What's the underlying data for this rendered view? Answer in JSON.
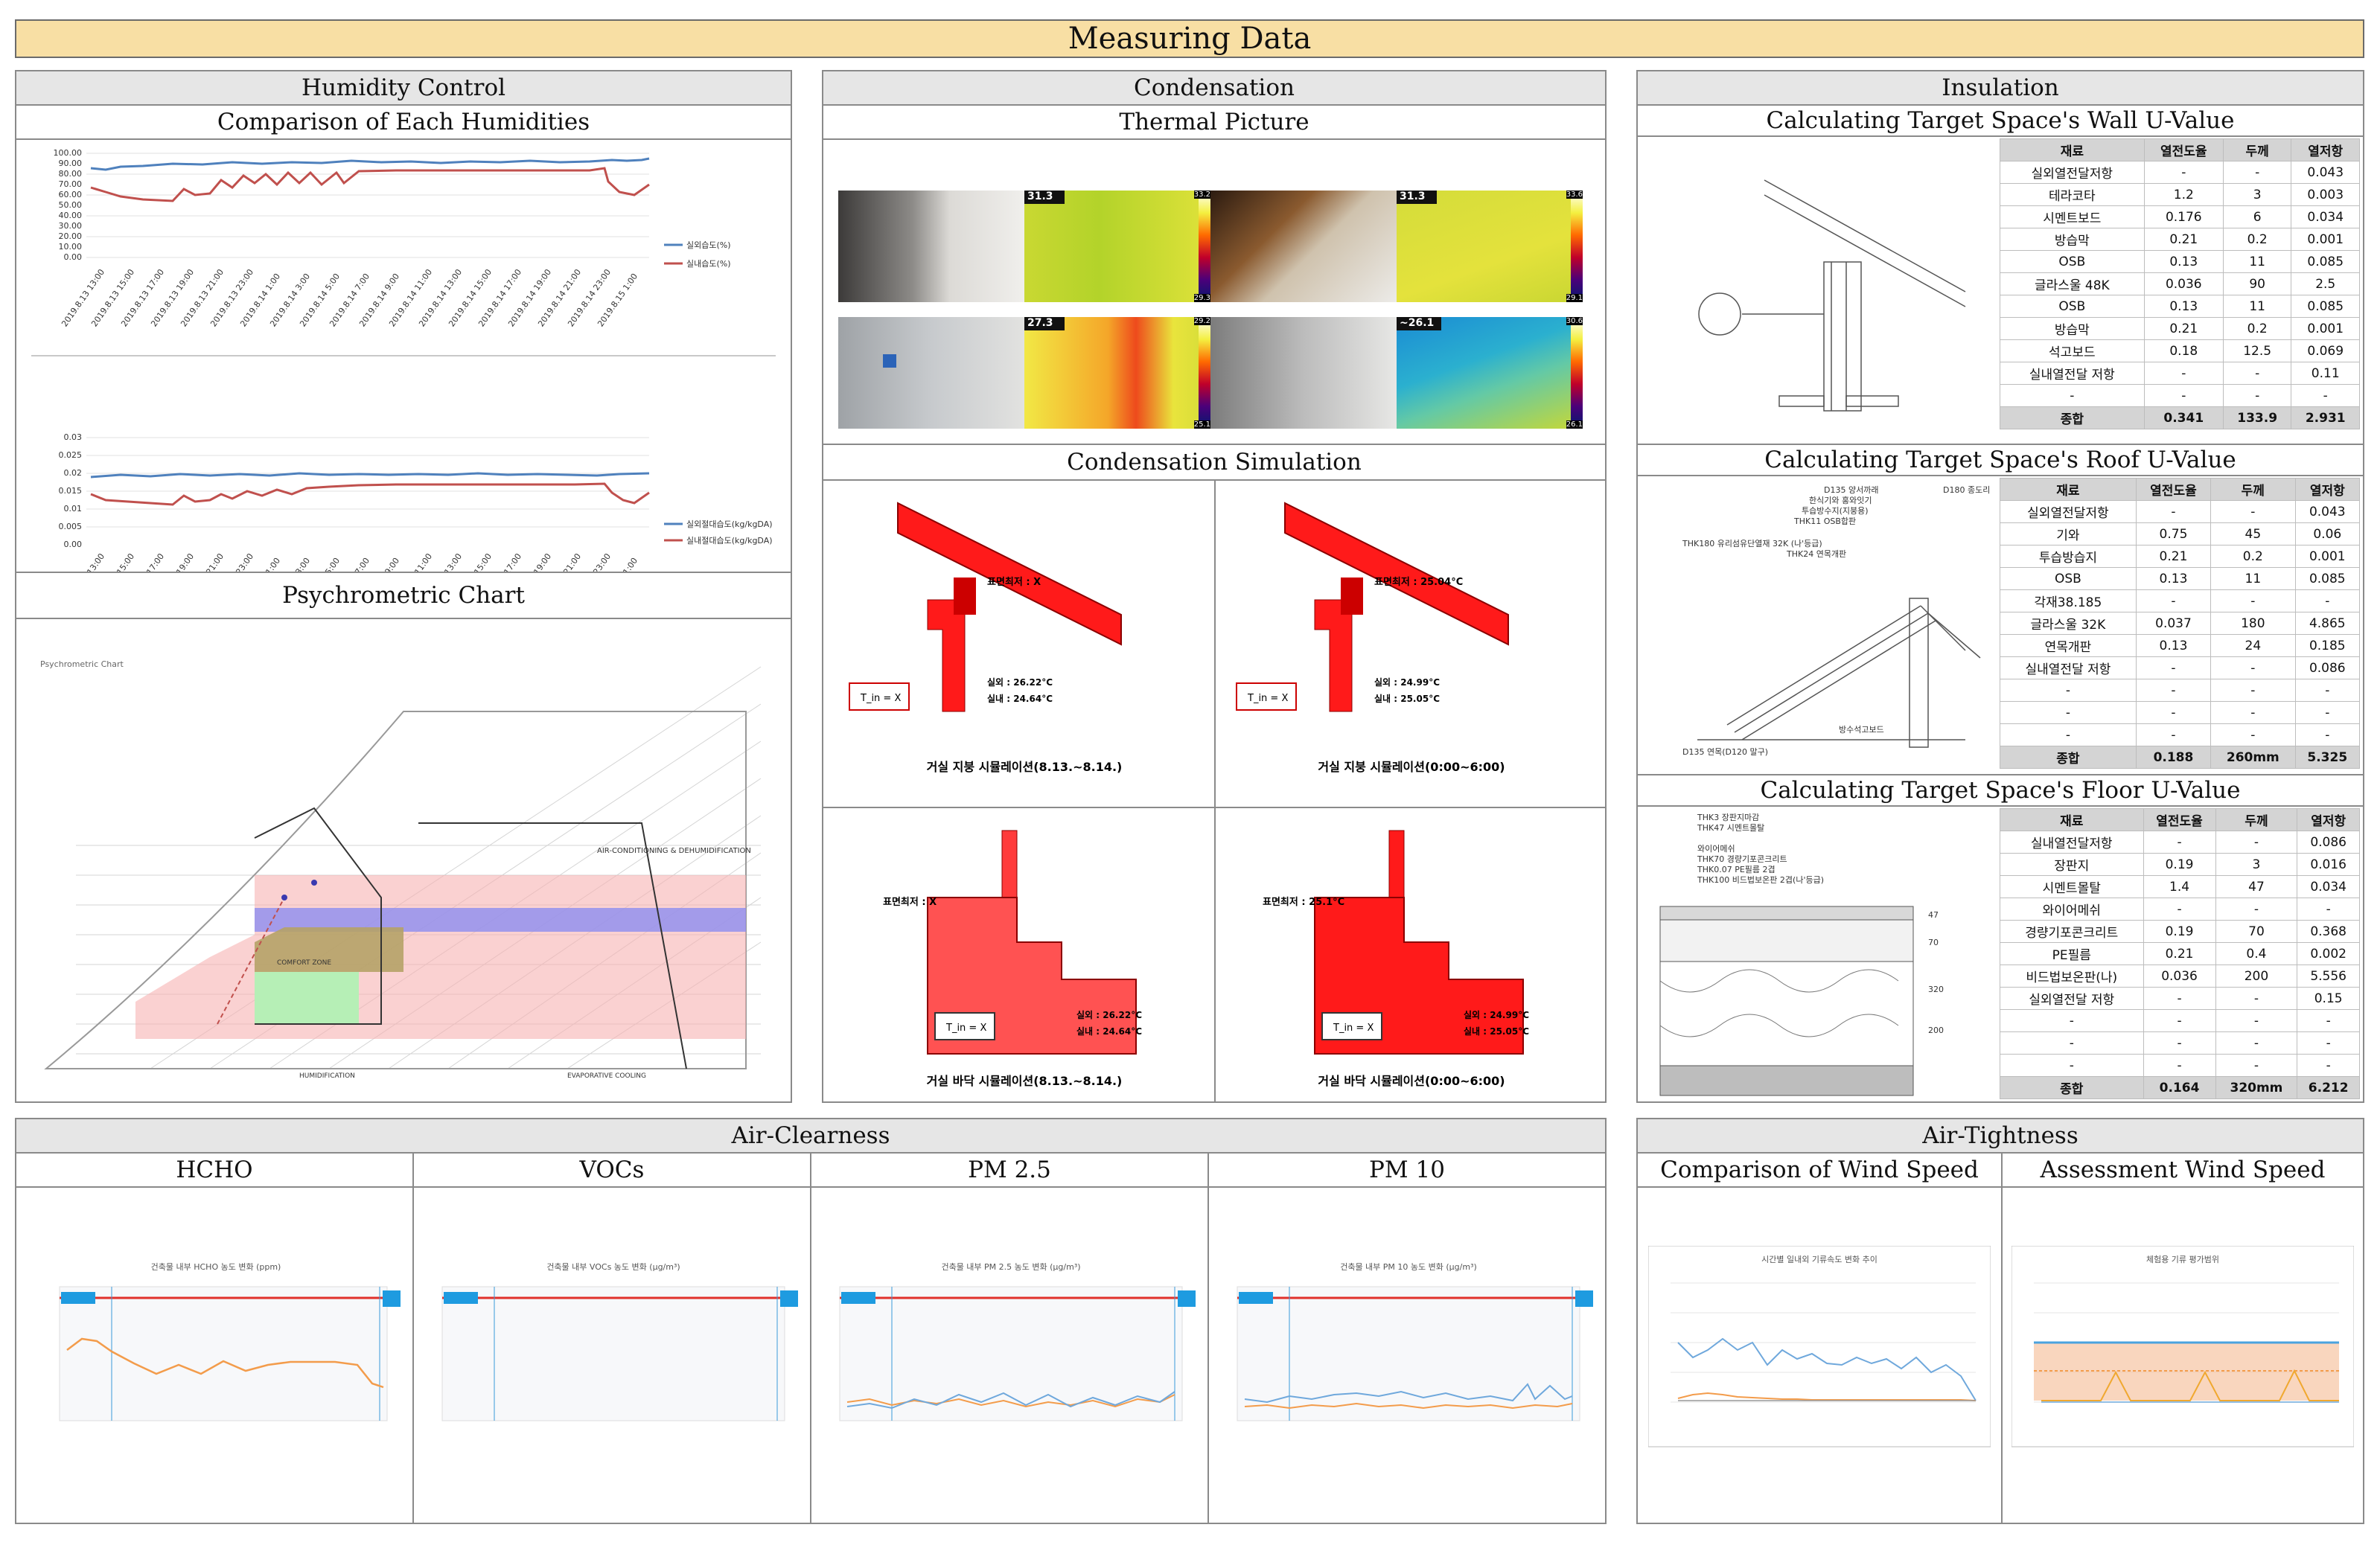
{
  "title": "Measuring Data",
  "humidity": {
    "header": "Humidity Control",
    "sub1": "Comparison of Each Humidities",
    "sub2": "Psychrometric Chart",
    "chart1": {
      "yticks": [
        "100.00",
        "90.00",
        "80.00",
        "70.00",
        "60.00",
        "50.00",
        "40.00",
        "30.00",
        "20.00",
        "10.00",
        "0.00"
      ],
      "legend": [
        "실외습도(%)",
        "실내습도(%)"
      ]
    },
    "chart2": {
      "yticks": [
        "0.03",
        "0.025",
        "0.02",
        "0.015",
        "0.01",
        "0.005",
        "0.00"
      ],
      "legend": [
        "실외절대습도(kg/kgDA)",
        "실내절대습도(kg/kgDA)"
      ]
    },
    "psychro": {
      "title": "Psychrometric Chart",
      "zones": [
        "AIR-CONDITIONING & DEHUMIDIFICATION",
        "COMFORT ZONE",
        "HUMIDIFICATION",
        "EVAPORATIVE COOLING"
      ]
    }
  },
  "condensation": {
    "header": "Condensation",
    "sub1": "Thermal Picture",
    "sub2": "Condensation Simulation",
    "thermal": [
      {
        "reading": "31.3",
        "max": "33.2",
        "min": "29.3"
      },
      {
        "reading": "31.3",
        "max": "33.6",
        "min": "29.1"
      },
      {
        "reading": "27.3",
        "max": "29.2",
        "min": "25.1"
      },
      {
        "reading": "~26.1",
        "max": "30.6",
        "min": "26.1"
      }
    ],
    "sims": [
      {
        "surface": "표면최저 : X",
        "out": "실외 : 26.22°C",
        "in": "실내 : 24.64°C",
        "box": "T_in = X",
        "caption": "거실 지붕 시뮬레이션(8.13.~8.14.)"
      },
      {
        "surface": "표면최저 : 25.04°C",
        "out": "실외 : 24.99°C",
        "in": "실내 : 25.05°C",
        "box": "T_in = X",
        "caption": "거실 지붕 시뮬레이션(0:00~6:00)"
      },
      {
        "surface": "표면최저 : X",
        "out": "실외 : 26.22°C",
        "in": "실내 : 24.64°C",
        "box": "T_in = X",
        "caption": "거실 바닥 시뮬레이션(8.13.~8.14.)"
      },
      {
        "surface": "표면최저 : 25.1°C",
        "out": "실외 : 24.99°C",
        "in": "실내 : 25.05°C",
        "box": "T_in = X",
        "caption": "거실 바닥 시뮬레이션(0:00~6:00)"
      }
    ]
  },
  "insulation": {
    "header": "Insulation",
    "wall": {
      "sub": "Calculating Target Space's Wall U-Value",
      "cols": [
        "재료",
        "열전도율",
        "두께",
        "열저항"
      ],
      "rows": [
        [
          "실외열전달저항",
          "-",
          "-",
          "0.043"
        ],
        [
          "테라코타",
          "1.2",
          "3",
          "0.003"
        ],
        [
          "시멘트보드",
          "0.176",
          "6",
          "0.034"
        ],
        [
          "방습막",
          "0.21",
          "0.2",
          "0.001"
        ],
        [
          "OSB",
          "0.13",
          "11",
          "0.085"
        ],
        [
          "글라스울 48K",
          "0.036",
          "90",
          "2.5"
        ],
        [
          "OSB",
          "0.13",
          "11",
          "0.085"
        ],
        [
          "방습막",
          "0.21",
          "0.2",
          "0.001"
        ],
        [
          "석고보드",
          "0.18",
          "12.5",
          "0.069"
        ],
        [
          "실내열전달 저항",
          "-",
          "-",
          "0.11"
        ],
        [
          "-",
          "-",
          "-",
          "-"
        ]
      ],
      "total": [
        "종합",
        "0.341",
        "133.9",
        "2.931"
      ]
    },
    "roof": {
      "sub": "Calculating Target Space's Roof U-Value",
      "cols": [
        "재료",
        "열전도율",
        "두께",
        "열저항"
      ],
      "rows": [
        [
          "실외열전달저항",
          "-",
          "-",
          "0.043"
        ],
        [
          "기와",
          "0.75",
          "45",
          "0.06"
        ],
        [
          "투습방습지",
          "0.21",
          "0.2",
          "0.001"
        ],
        [
          "OSB",
          "0.13",
          "11",
          "0.085"
        ],
        [
          "각재38.185",
          "-",
          "-",
          "-"
        ],
        [
          "글라스울 32K",
          "0.037",
          "180",
          "4.865"
        ],
        [
          "연목개판",
          "0.13",
          "24",
          "0.185"
        ],
        [
          "실내열전달 저항",
          "-",
          "-",
          "0.086"
        ],
        [
          "-",
          "-",
          "-",
          "-"
        ],
        [
          "-",
          "-",
          "-",
          "-"
        ],
        [
          "-",
          "-",
          "-",
          "-"
        ]
      ],
      "total": [
        "종합",
        "0.188",
        "260mm",
        "5.325"
      ],
      "labels": [
        "D135 양서까래",
        "한식기와 홍와잇기",
        "투습방수지(지붕용)",
        "THK11 OSB합판",
        "THK180 유리섬유단열재 32K (나'등급)",
        "THK24 연목개판",
        "D180 종도리",
        "D135 연목(D120 말구)",
        "방수석고보드"
      ]
    },
    "floor": {
      "sub": "Calculating Target Space's Floor U-Value",
      "cols": [
        "재료",
        "열전도율",
        "두께",
        "열저항"
      ],
      "rows": [
        [
          "실내열전달저항",
          "-",
          "-",
          "0.086"
        ],
        [
          "장판지",
          "0.19",
          "3",
          "0.016"
        ],
        [
          "시멘트몰탈",
          "1.4",
          "47",
          "0.034"
        ],
        [
          "와이어메쉬",
          "-",
          "-",
          "-"
        ],
        [
          "경량기포콘크리트",
          "0.19",
          "70",
          "0.368"
        ],
        [
          "PE필름",
          "0.21",
          "0.4",
          "0.002"
        ],
        [
          "비드법보온판(나)",
          "0.036",
          "200",
          "5.556"
        ],
        [
          "실외열전달 저항",
          "-",
          "-",
          "0.15"
        ],
        [
          "-",
          "-",
          "-",
          "-"
        ],
        [
          "-",
          "-",
          "-",
          "-"
        ],
        [
          "-",
          "-",
          "-",
          "-"
        ]
      ],
      "total": [
        "종합",
        "0.164",
        "320mm",
        "6.212"
      ],
      "labels": [
        "THK3 장판지마감",
        "THK47 시멘트몰탈",
        "와이어메쉬",
        "THK70 경량기포콘크리트",
        "THK0.07 PE필름 2겹",
        "THK100 비드법보온판 2겹(나'등급)"
      ],
      "dims": [
        "47",
        "70",
        "320",
        "200"
      ]
    }
  },
  "air_clearness": {
    "header": "Air-Clearness",
    "subs": [
      "HCHO",
      "VOCs",
      "PM 2.5",
      "PM 10"
    ],
    "chart_titles": [
      "건축물 내부 HCHO 농도 변화 (ppm)",
      "건축물 내부 VOCs 농도 변화 (μg/m³)",
      "건축물 내부 PM 2.5 농도 변화 (μg/m³)",
      "건축물 내부 PM 10 농도 변화 (μg/m³)"
    ]
  },
  "air_tightness": {
    "header": "Air-Tightness",
    "subs": [
      "Comparison of Wind Speed",
      "Assessment Wind Speed"
    ],
    "chart_titles": [
      "시간별 일내외 기류속도 변화 추이",
      "체험용 기류 평가범위"
    ]
  },
  "colors": {
    "banner": "#f8dfa4",
    "header": "#e6e6e6",
    "outdoor": "#4f81bd",
    "indoor": "#c0504d",
    "limit": "#e0312a",
    "orange": "#f39c4b",
    "sim_red": "#ff1a1a"
  }
}
